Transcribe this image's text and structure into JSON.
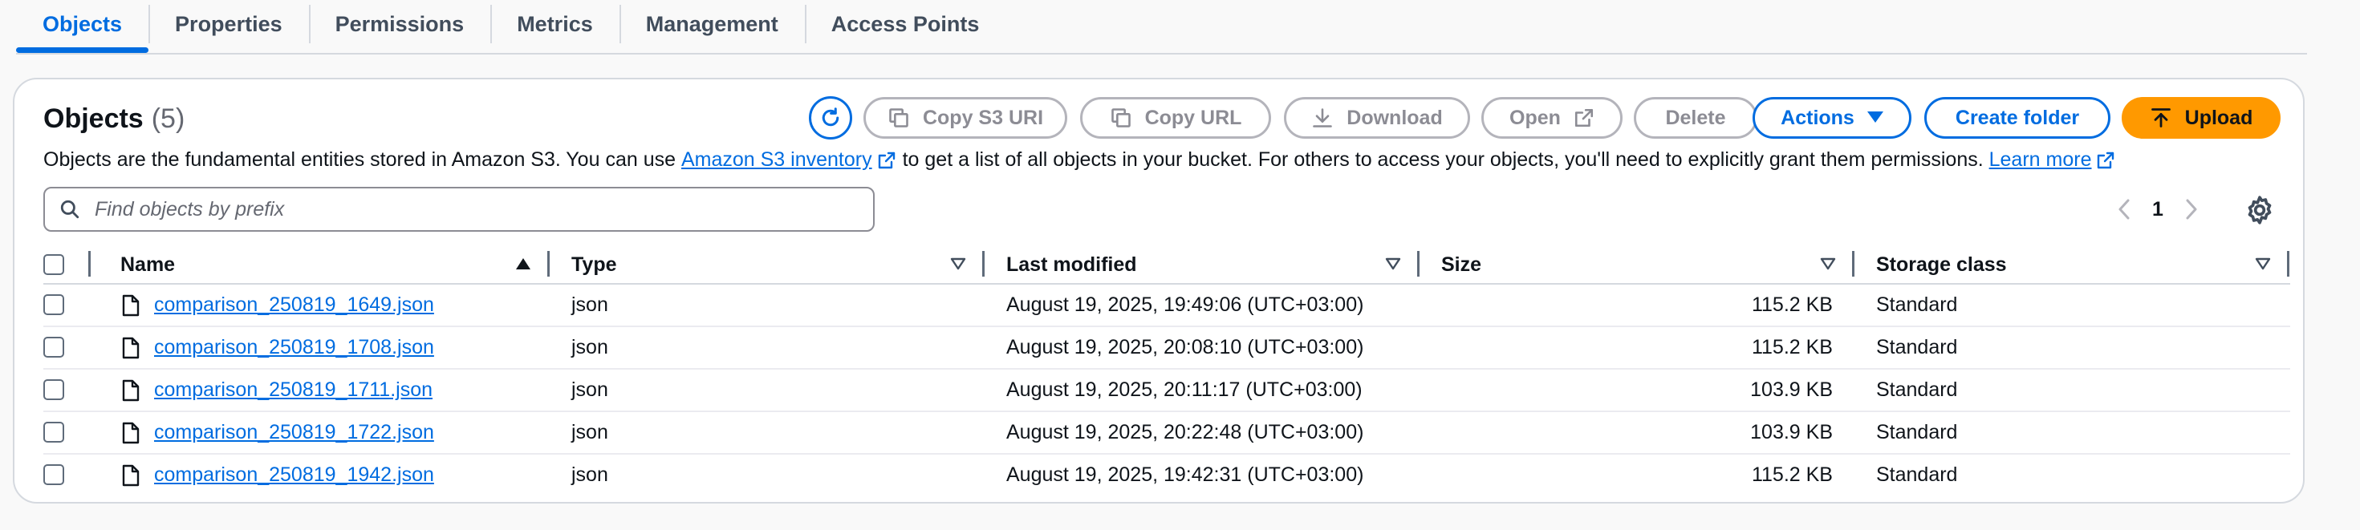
{
  "tabs": [
    {
      "label": "Objects",
      "active": true
    },
    {
      "label": "Properties",
      "active": false
    },
    {
      "label": "Permissions",
      "active": false
    },
    {
      "label": "Metrics",
      "active": false
    },
    {
      "label": "Management",
      "active": false
    },
    {
      "label": "Access Points",
      "active": false
    }
  ],
  "objects": {
    "title": "Objects",
    "count": "(5)",
    "buttons": {
      "refresh_icon": "refresh-icon",
      "copy_s3_uri": "Copy S3 URI",
      "copy_url": "Copy URL",
      "download": "Download",
      "open": "Open",
      "delete": "Delete",
      "actions": "Actions",
      "create_folder": "Create folder",
      "upload": "Upload"
    },
    "description": {
      "before": "Objects are the fundamental entities stored in Amazon S3. You can use",
      "link1": "Amazon S3 inventory",
      "middle": "to get a list of all objects in your bucket. For others to access your objects, you'll need to explicitly grant them permissions.",
      "link2": "Learn more"
    },
    "search": {
      "placeholder": "Find objects by prefix",
      "value": ""
    },
    "pagination": {
      "current_page": "1"
    },
    "columns": [
      "Name",
      "Type",
      "Last modified",
      "Size",
      "Storage class"
    ],
    "rows": [
      {
        "name": "comparison_250819_1649.json",
        "type": "json",
        "modified": "August 19, 2025, 19:49:06 (UTC+03:00)",
        "size": "115.2 KB",
        "storage": "Standard"
      },
      {
        "name": "comparison_250819_1708.json",
        "type": "json",
        "modified": "August 19, 2025, 20:08:10 (UTC+03:00)",
        "size": "115.2 KB",
        "storage": "Standard"
      },
      {
        "name": "comparison_250819_1711.json",
        "type": "json",
        "modified": "August 19, 2025, 20:11:17 (UTC+03:00)",
        "size": "103.9 KB",
        "storage": "Standard"
      },
      {
        "name": "comparison_250819_1722.json",
        "type": "json",
        "modified": "August 19, 2025, 20:22:48 (UTC+03:00)",
        "size": "103.9 KB",
        "storage": "Standard"
      },
      {
        "name": "comparison_250819_1942.json",
        "type": "json",
        "modified": "August 19, 2025, 19:42:31 (UTC+03:00)",
        "size": "115.2 KB",
        "storage": "Standard"
      }
    ]
  },
  "colors": {
    "accent": "#006ce0",
    "primary_button": "#ff9900",
    "disabled": "#8c8c94"
  }
}
